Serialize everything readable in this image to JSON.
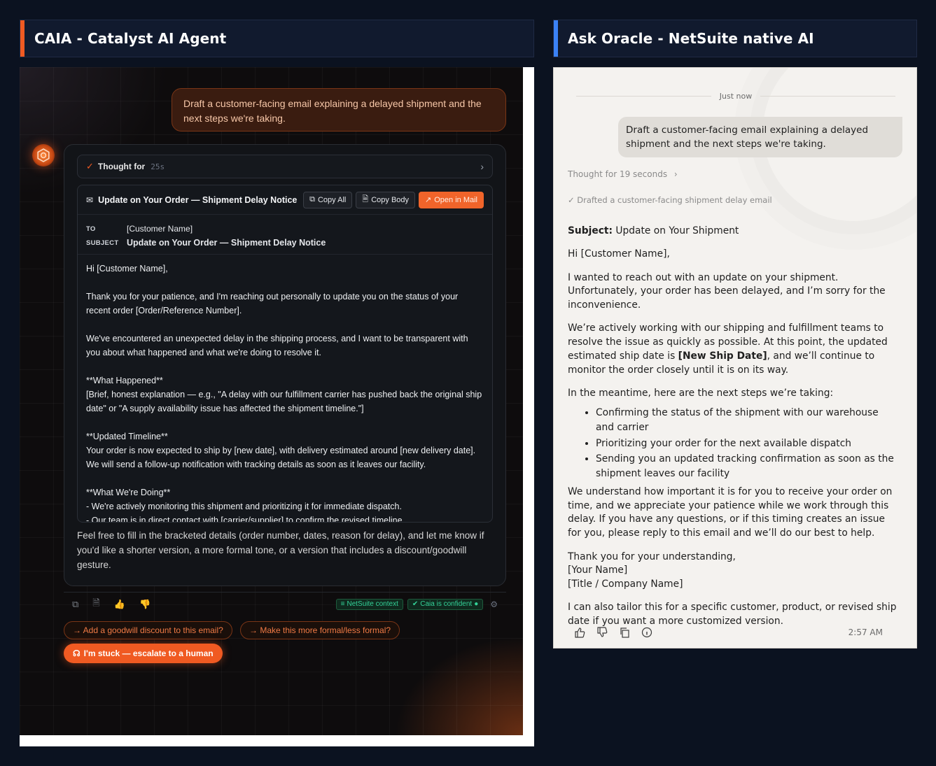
{
  "left_panel": {
    "title": "CAIA - Catalyst AI Agent",
    "accent": "#f05a22",
    "user_message": "Draft a customer-facing email explaining a delayed shipment and the next steps we're taking.",
    "thought": {
      "label": "Thought for",
      "duration": "25s"
    },
    "email": {
      "toolbar_subject": "Update on Your Order — Shipment Delay Notice",
      "copy_all": "Copy All",
      "copy_body": "Copy Body",
      "open_in_mail": "Open in Mail",
      "to_key": "TO",
      "to_value": "[Customer Name]",
      "subject_key": "SUBJECT",
      "subject_value": "Update on Your Order — Shipment Delay Notice",
      "body": "Hi [Customer Name],\n\nThank you for your patience, and I'm reaching out personally to update you on the status of your recent order [Order/Reference Number].\n\nWe've encountered an unexpected delay in the shipping process, and I want to be transparent with you about what happened and what we're doing to resolve it.\n\n**What Happened**\n[Brief, honest explanation — e.g., \"A delay with our fulfillment carrier has pushed back the original ship date\" or \"A supply availability issue has affected the shipment timeline.\"]\n\n**Updated Timeline**\nYour order is now expected to ship by [new date], with delivery estimated around [new delivery date]. We will send a follow-up notification with tracking details as soon as it leaves our facility.\n\n**What We're Doing**\n- We're actively monitoring this shipment and prioritizing it for immediate dispatch.\n- Our team is in direct contact with [carrier/supplier] to confirm the revised timeline."
    },
    "followup": "Feel free to fill in the bracketed details (order number, dates, reason for delay), and let me know if you'd like a shorter version, a more formal tone, or a version that includes a discount/goodwill gesture.",
    "badges": {
      "netsuite": "NetSuite context",
      "confident": "Caia is confident"
    },
    "suggestions": [
      "→ Add a goodwill discount to this email?",
      "→ Make this more formal/less formal?"
    ],
    "escalate": "I'm stuck — escalate to a human"
  },
  "right_panel": {
    "title": "Ask Oracle - NetSuite native AI",
    "accent": "#3b82f6",
    "timestamp": "Just now",
    "user_message": "Draft a customer-facing email explaining a delayed shipment and the next steps we're taking.",
    "thought": "Thought for 19 seconds",
    "drafted": "Drafted a customer-facing shipment delay email",
    "reply": {
      "subject_label": "Subject:",
      "subject": "Update on Your Shipment",
      "greeting": "Hi [Customer Name],",
      "p1": "I wanted to reach out with an update on your shipment. Unfortunately, your order has been delayed, and I’m sorry for the inconvenience.",
      "p2_a": "We’re actively working with our shipping and fulfillment teams to resolve the issue as quickly as possible. At this point, the updated estimated ship date is ",
      "p2_bold": "[New Ship Date]",
      "p2_b": ", and we’ll continue to monitor the order closely until it is on its way.",
      "p3": "In the meantime, here are the next steps we’re taking:",
      "steps": [
        "Confirming the status of the shipment with our warehouse and carrier",
        "Prioritizing your order for the next available dispatch",
        "Sending you an updated tracking confirmation as soon as the shipment leaves our facility"
      ],
      "p4": "We understand how important it is for you to receive your order on time, and we appreciate your patience while we work through this delay. If you have any questions, or if this timing creates an issue for you, please reply to this email and we’ll do our best to help.",
      "closing": "Thank you for your understanding,",
      "sig_name": "[Your Name]",
      "sig_title": "[Title / Company Name]",
      "p5": "I can also tailor this for a specific customer, product, or revised ship date if you want a more customized version."
    },
    "time": "2:57 AM"
  }
}
